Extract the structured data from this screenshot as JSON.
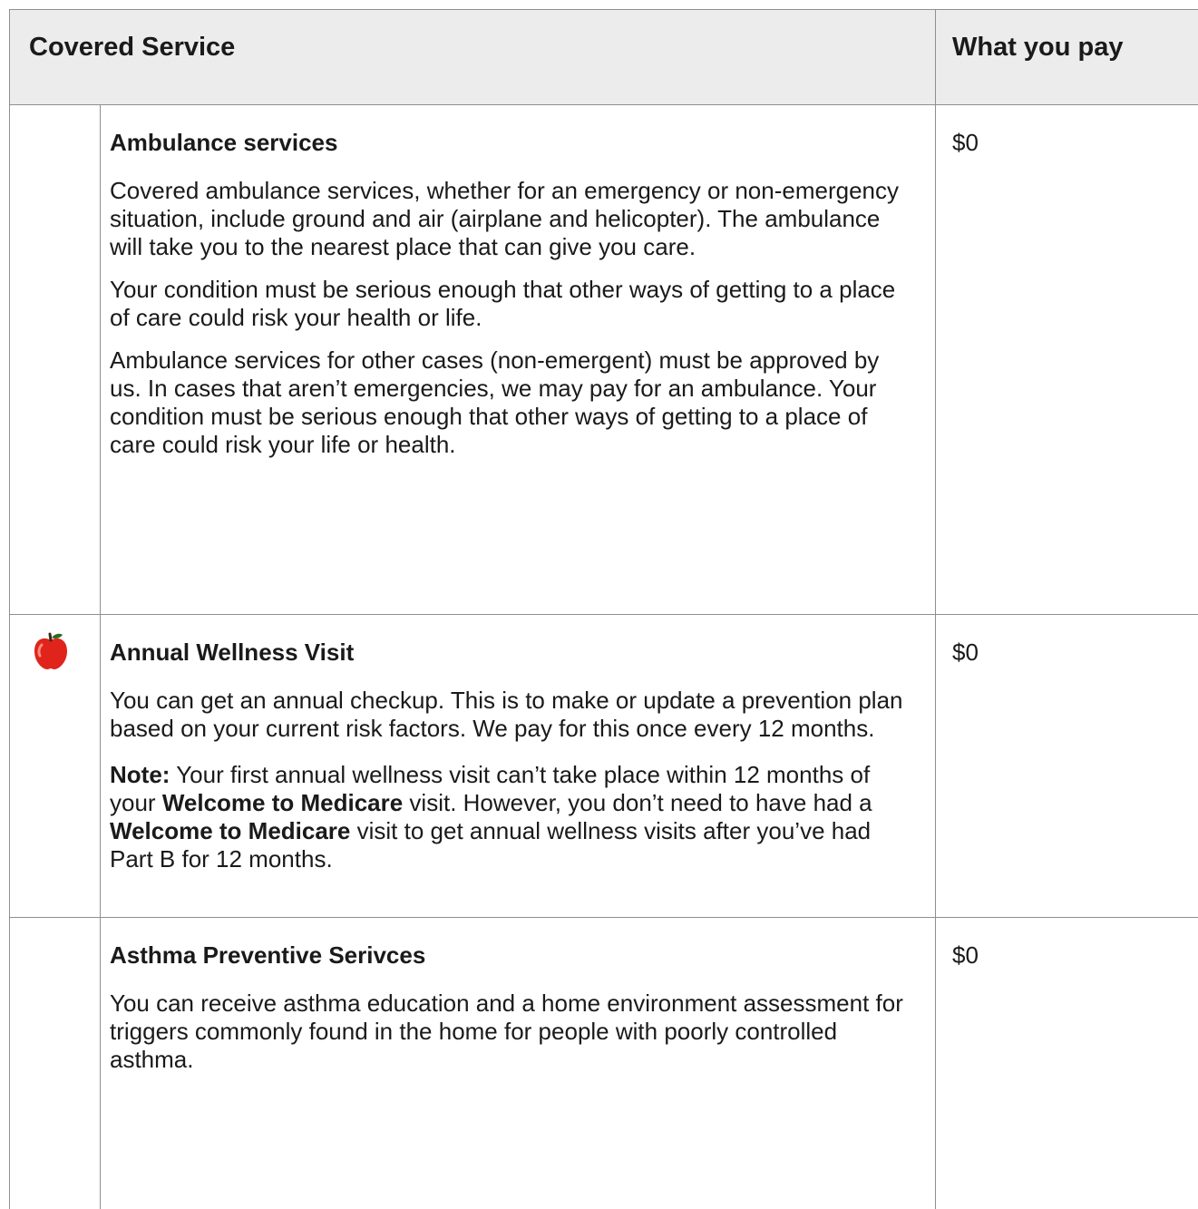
{
  "header": {
    "covered_service": "Covered Service",
    "what_you_pay": "What you pay"
  },
  "rows": [
    {
      "title": "Ambulance services",
      "paragraphs": [
        "Covered ambulance services, whether for an emergency or non-emergency situation, include ground and air (airplane and helicopter). The ambulance will take you to the nearest place that can give you care.",
        "Your condition must be serious enough that other ways of getting to a place of care could risk your health or life.",
        "Ambulance services for other cases (non-emergent) must be approved by us. In cases that aren’t emergencies, we may pay for an ambulance. Your condition must be serious enough that other ways of getting to a place of care could risk your life or health."
      ],
      "pay": "$0",
      "icon": ""
    },
    {
      "title": "Annual Wellness Visit",
      "paragraphs": [
        "You can get an annual checkup. This is to make or update a prevention plan based on your current risk factors. We pay for this once every 12 months."
      ],
      "note": {
        "label": "Note:",
        "t1": " Your first annual wellness visit can’t take place within 12 months of your ",
        "b1": "Welcome to Medicare",
        "t2": " visit. However, you don’t need to have had a ",
        "b2": "Welcome to Medicare",
        "t3": " visit to get annual wellness visits after you’ve had Part B for 12 months."
      },
      "pay": "$0",
      "icon": "apple-icon"
    },
    {
      "title": "Asthma Preventive Serivces",
      "paragraphs": [
        "You can receive asthma education and a home environment assessment for triggers commonly found in the home for people with poorly controlled asthma."
      ],
      "pay": "$0",
      "icon": ""
    }
  ],
  "colors": {
    "header_bg": "#ececec",
    "grid": "#8f8f8f",
    "text": "#1a1a1a",
    "apple_red": "#e0241b"
  }
}
